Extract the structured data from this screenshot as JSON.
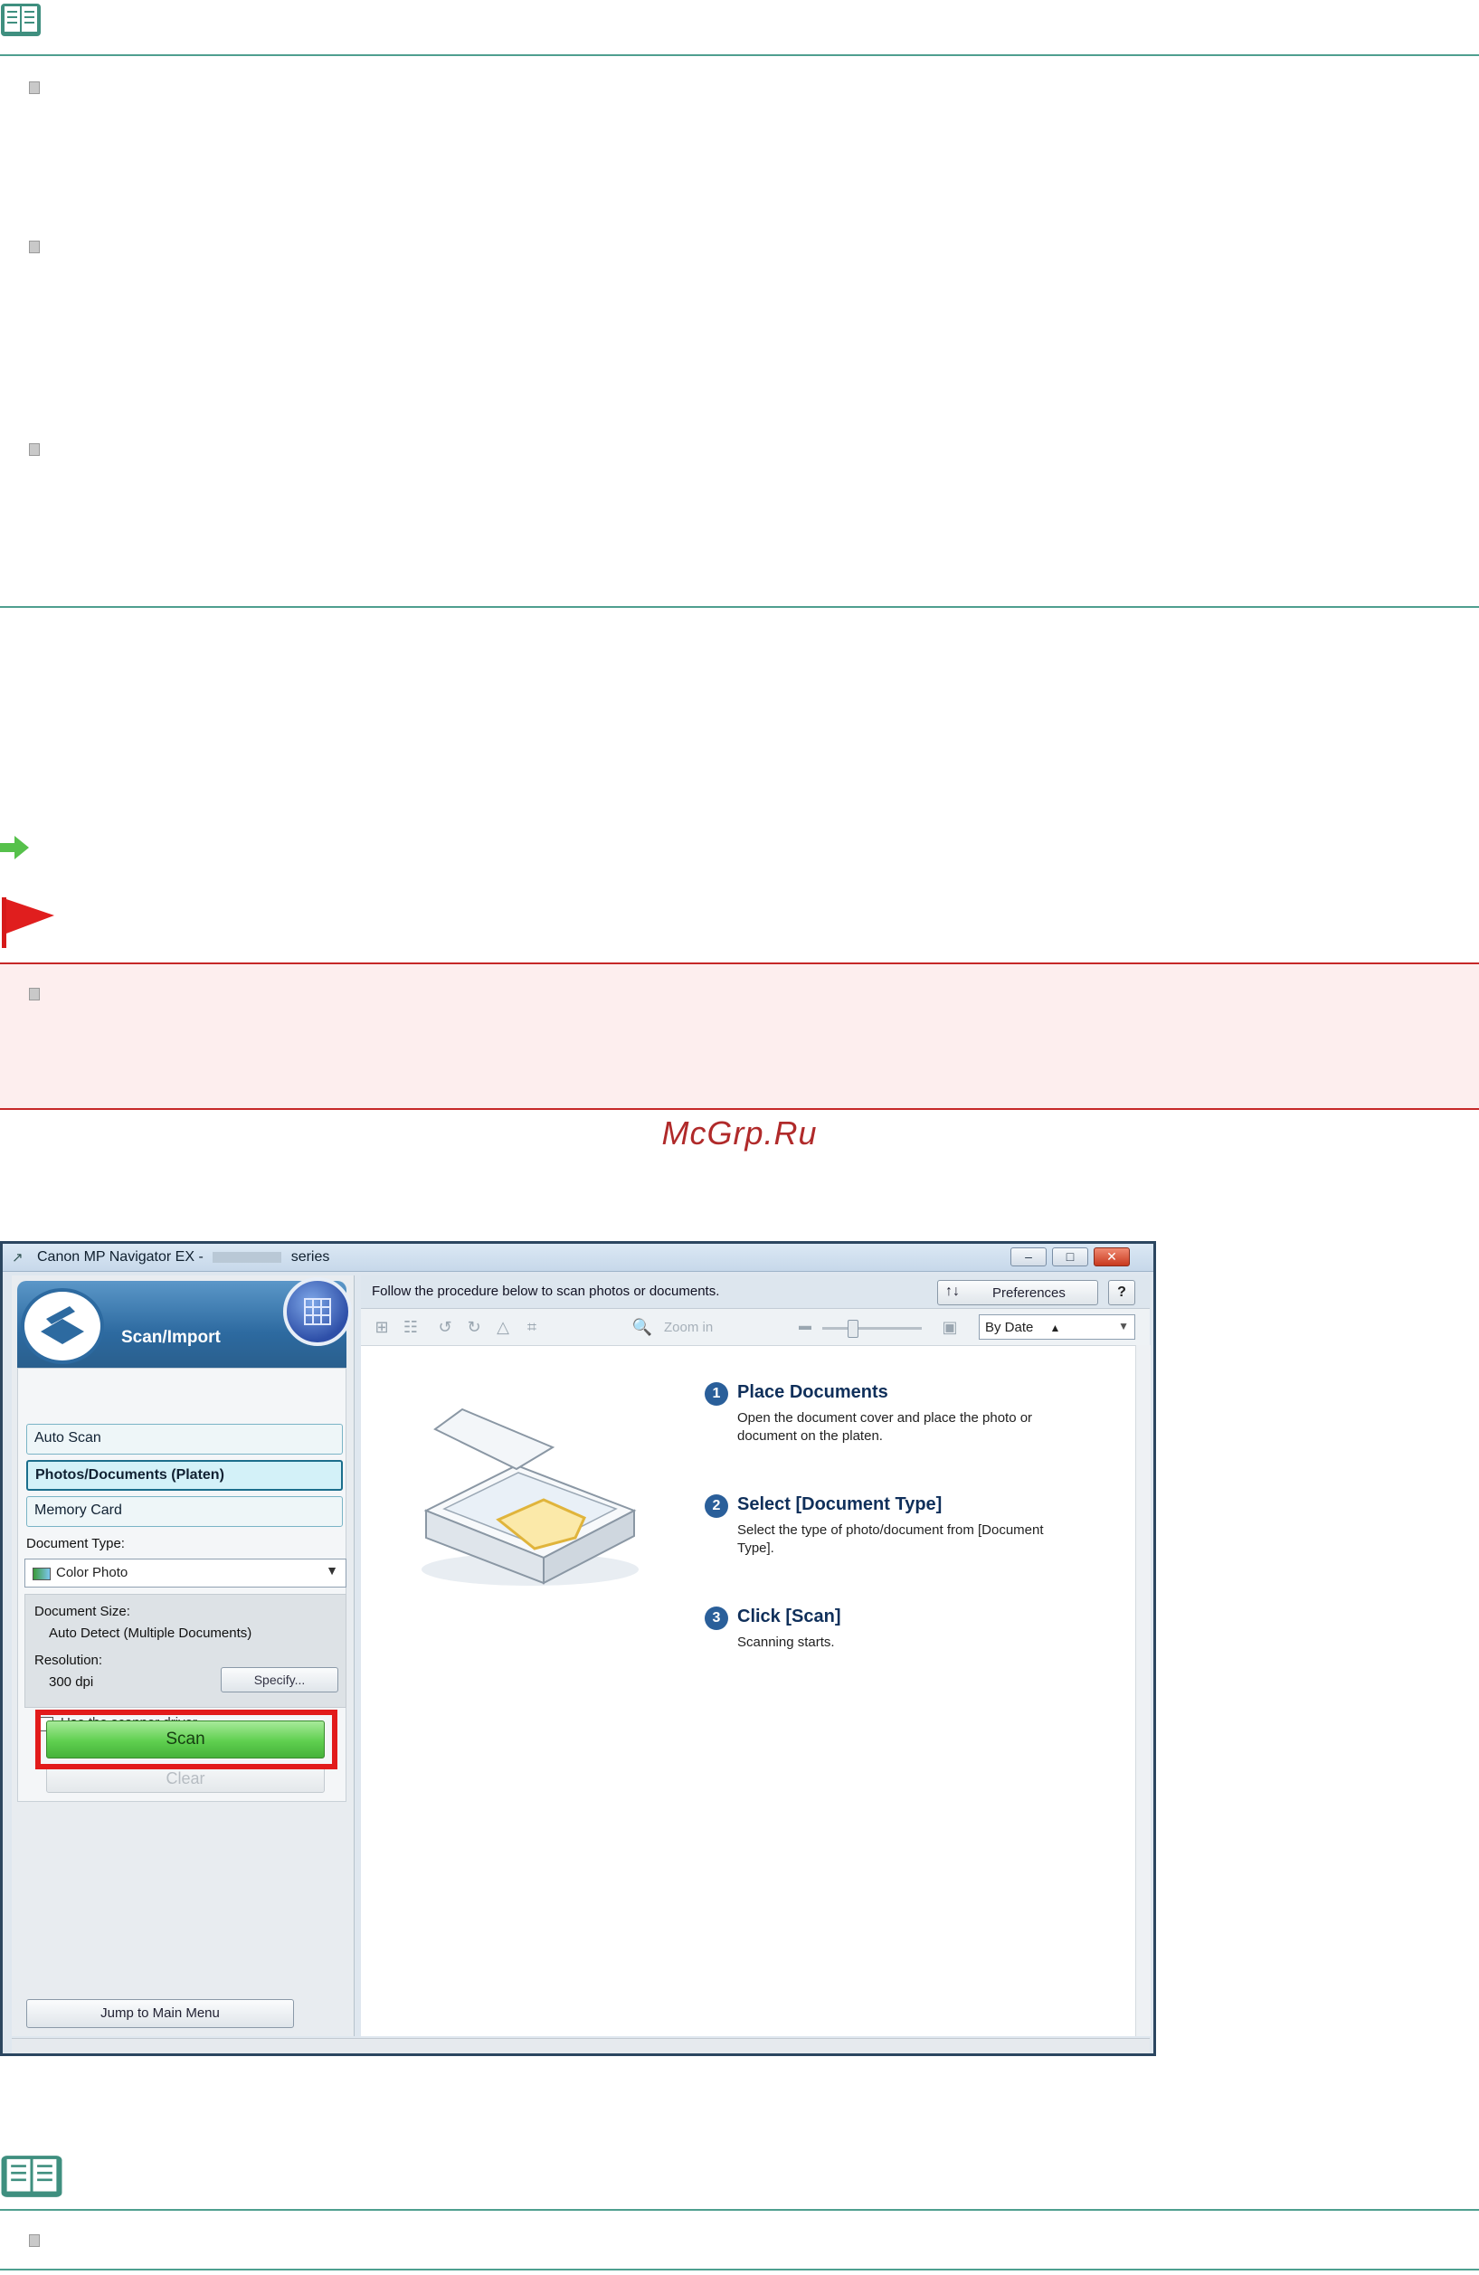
{
  "watermark": "McGrp.Ru",
  "window": {
    "title_prefix": "Canon MP Navigator EX -",
    "title_suffix": "series"
  },
  "left_panel": {
    "header": "Scan/Import",
    "menu": [
      "Auto Scan",
      "Photos/Documents (Platen)",
      "Memory Card"
    ],
    "document_type_label": "Document Type:",
    "document_type_value": "Color Photo",
    "document_size_label": "Document Size:",
    "document_size_value": "Auto Detect (Multiple Documents)",
    "resolution_label": "Resolution:",
    "resolution_value": "300 dpi",
    "specify_button": "Specify...",
    "scanner_driver_label": "Use the scanner driver",
    "scan_button": "Scan",
    "clear_button": "Clear",
    "jump_button": "Jump to Main Menu"
  },
  "right_panel": {
    "instruction": "Follow the procedure below to scan photos or documents.",
    "preferences_button": "Preferences",
    "help_button": "?",
    "zoom_label": "Zoom in",
    "sort_value": "By Date",
    "steps": [
      {
        "num": "1",
        "title": "Place Documents",
        "desc": "Open the document cover and place the photo or document on the platen."
      },
      {
        "num": "2",
        "title": "Select [Document Type]",
        "desc": "Select the type of photo/document from [Document Type]."
      },
      {
        "num": "3",
        "title": "Click [Scan]",
        "desc": "Scanning starts."
      }
    ]
  }
}
